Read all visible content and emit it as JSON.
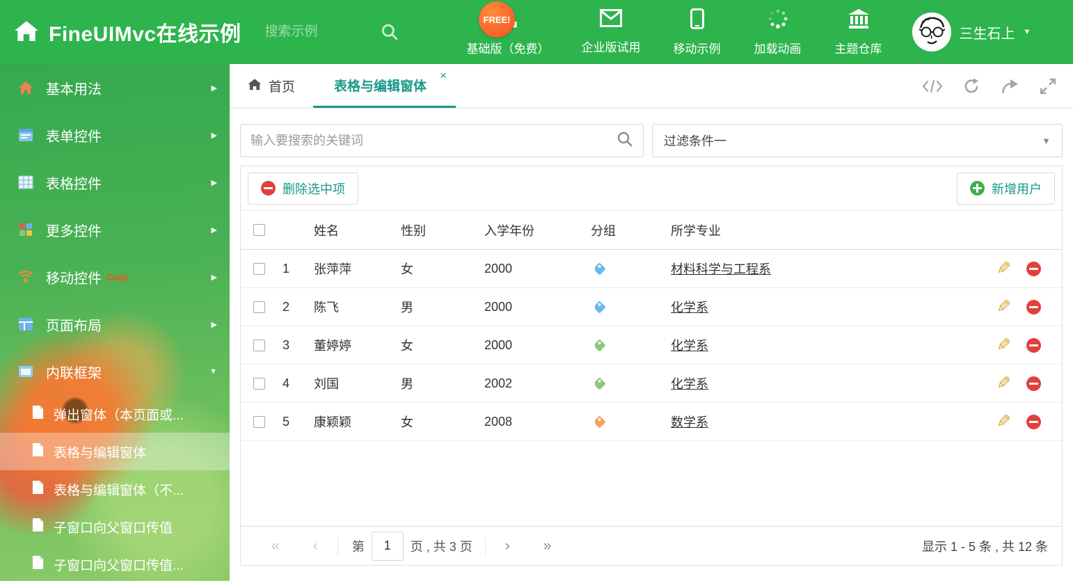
{
  "colors": {
    "header_green": "#2db44d",
    "accent_teal": "#17988a",
    "tag_blue": "#6cb8ea",
    "tag_green": "#8cc87c",
    "tag_orange": "#f2a45c",
    "delete_red": "#e2403c",
    "edit_yellow": "#d9a326",
    "free_badge_orange": "#f4511e"
  },
  "header": {
    "title": "FineUIMvc在线示例",
    "search_placeholder": "搜索示例",
    "free_badge": "FREE!",
    "nav": [
      {
        "label": "基础版（免费）"
      },
      {
        "label": "企业版试用"
      },
      {
        "label": "移动示例"
      },
      {
        "label": "加载动画"
      },
      {
        "label": "主题仓库"
      }
    ],
    "username": "三生石上"
  },
  "sidebar": {
    "items": [
      {
        "label": "基本用法"
      },
      {
        "label": "表单控件"
      },
      {
        "label": "表格控件"
      },
      {
        "label": "更多控件"
      },
      {
        "label": "移动控件",
        "badge": "Corp."
      },
      {
        "label": "页面布局"
      },
      {
        "label": "内联框架"
      }
    ],
    "subitems": [
      {
        "label": "弹出窗体（本页面或..."
      },
      {
        "label": "表格与编辑窗体"
      },
      {
        "label": "表格与编辑窗体（不..."
      },
      {
        "label": "子窗口向父窗口传值"
      },
      {
        "label": "子窗口向父窗口传值..."
      }
    ]
  },
  "tabs": {
    "home": "首页",
    "active": "表格与编辑窗体"
  },
  "filter": {
    "search_placeholder": "输入要搜索的关键词",
    "dropdown_value": "过滤条件一"
  },
  "toolbar": {
    "delete_label": "删除选中项",
    "add_label": "新增用户"
  },
  "table": {
    "headers": {
      "name": "姓名",
      "gender": "性别",
      "year": "入学年份",
      "group": "分组",
      "major": "所学专业"
    },
    "rows": [
      {
        "num": "1",
        "name": "张萍萍",
        "gender": "女",
        "year": "2000",
        "tag": "blue",
        "major": "材料科学与工程系"
      },
      {
        "num": "2",
        "name": "陈飞",
        "gender": "男",
        "year": "2000",
        "tag": "blue",
        "major": "化学系"
      },
      {
        "num": "3",
        "name": "董婷婷",
        "gender": "女",
        "year": "2000",
        "tag": "green",
        "major": "化学系"
      },
      {
        "num": "4",
        "name": "刘国",
        "gender": "男",
        "year": "2002",
        "tag": "green",
        "major": "化学系"
      },
      {
        "num": "5",
        "name": "康颖颖",
        "gender": "女",
        "year": "2008",
        "tag": "orange",
        "major": "数学系"
      }
    ]
  },
  "pagination": {
    "page_label": "第",
    "current_page": "1",
    "total_label": "页 , 共 3 页",
    "summary": "显示 1 - 5 条 , 共 12 条"
  }
}
